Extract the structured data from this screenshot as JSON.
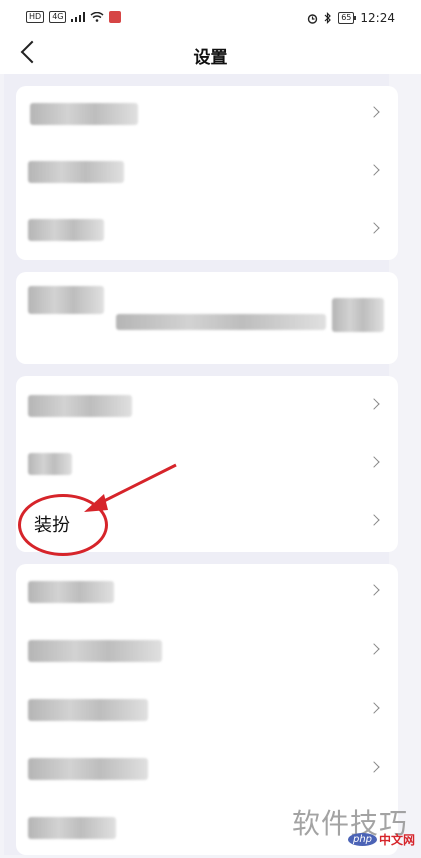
{
  "status_bar": {
    "hd_badge": "HD",
    "network_badge": "4G",
    "battery_level": "65",
    "time": "12:24"
  },
  "header": {
    "title": "设置"
  },
  "section_3": {
    "highlighted_item_label": "装扮"
  },
  "watermark": {
    "text": "软件技巧",
    "logo_php": "php",
    "logo_site": "中文网"
  },
  "colors": {
    "annotation": "#d6242a",
    "background": "#eeeef6",
    "card": "#ffffff"
  }
}
